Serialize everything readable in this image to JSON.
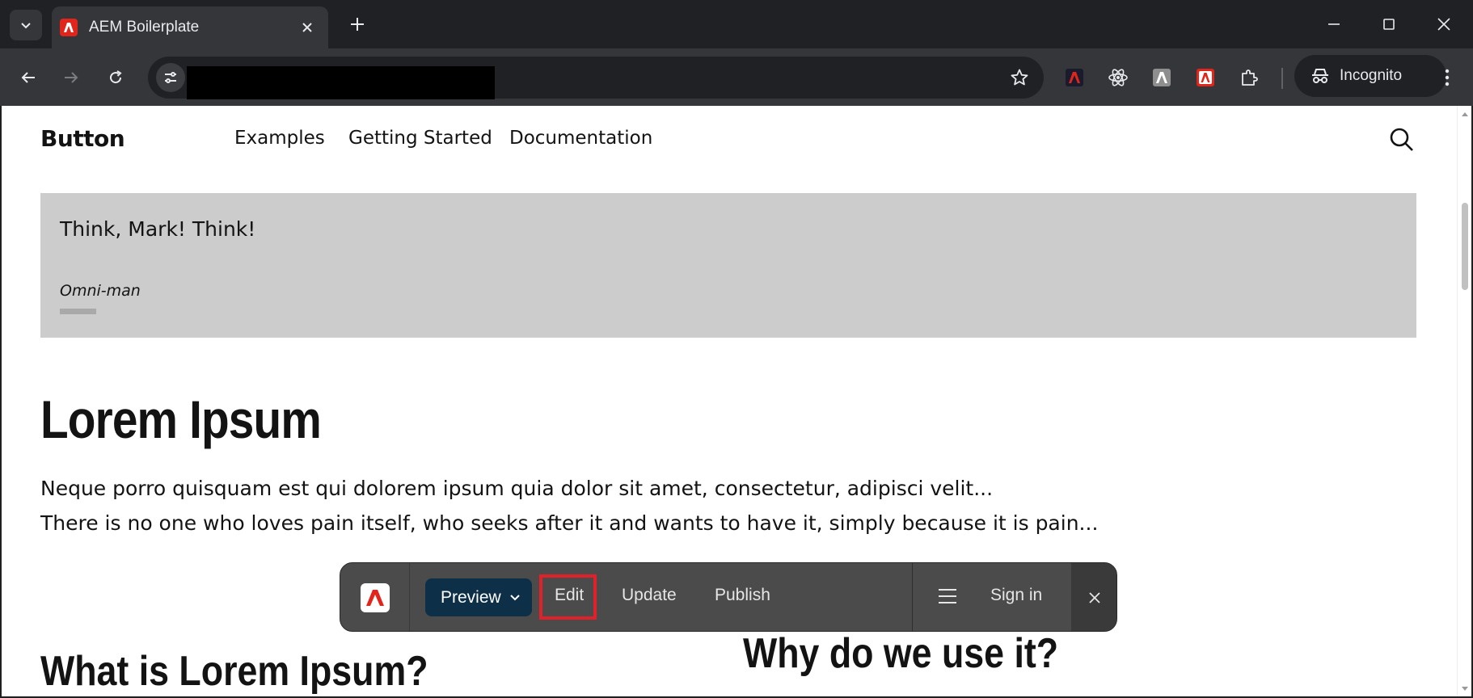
{
  "browser": {
    "tab_title": "AEM Boilerplate",
    "incognito_label": "Incognito"
  },
  "site": {
    "brand": "Button",
    "nav": [
      "Examples",
      "Getting Started",
      "Documentation"
    ]
  },
  "quote": {
    "text": "Think, Mark! Think!",
    "author": "Omni-man"
  },
  "content": {
    "heading": "Lorem Ipsum",
    "paragraph_1": "Neque porro quisquam est qui dolorem ipsum quia dolor sit amet, consectetur, adipisci velit...",
    "paragraph_2": "There is no one who loves pain itself, who seeks after it and wants to have it, simply because it is pain...",
    "subheading_left": "What is Lorem Ipsum?",
    "subheading_right": "Why do we use it?"
  },
  "sidekick": {
    "env_label": "Preview",
    "edit_label": "Edit",
    "update_label": "Update",
    "publish_label": "Publish",
    "signin_label": "Sign in",
    "accent_color": "#e2202a",
    "preview_bg": "#0d2f48"
  }
}
